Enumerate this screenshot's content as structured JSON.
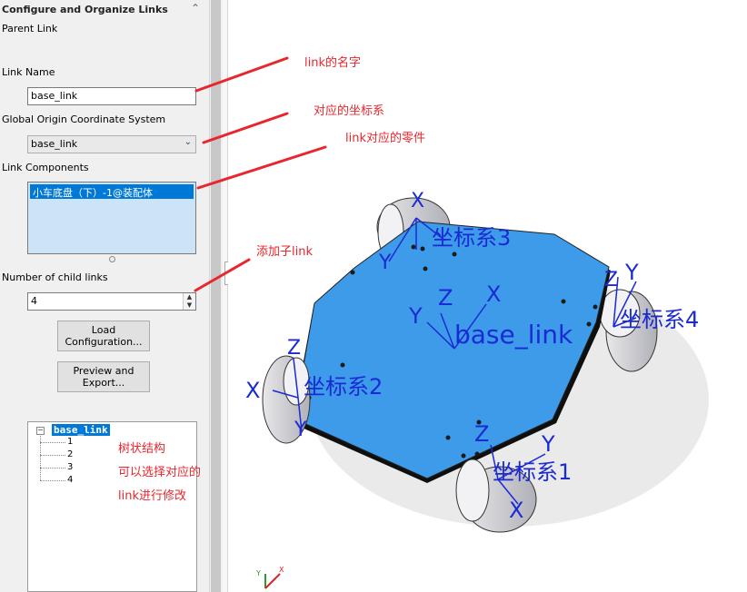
{
  "panel": {
    "title": "Configure and Organize Links",
    "parent_link_label": "Parent Link",
    "link_name_label": "Link Name",
    "link_name_value": "base_link",
    "coord_sys_label": "Global Origin Coordinate System",
    "coord_sys_value": "base_link",
    "components_label": "Link Components",
    "component_selected": "小车底盘（下）-1@装配体",
    "child_links_label": "Number of child links",
    "child_links_value": "4",
    "load_button": "Load\nConfiguration...",
    "preview_button": "Preview and\nExport...",
    "tree": {
      "root": "base_link",
      "toggle": "−",
      "children": [
        "1",
        "2",
        "3",
        "4"
      ]
    }
  },
  "annotations": {
    "link_name": "link的名字",
    "coord_sys": "对应的坐标系",
    "components": "link对应的零件",
    "child_links": "添加子link",
    "tree_lines": [
      "树状结构",
      "可以选择对应的",
      "link进行修改"
    ]
  },
  "viewport": {
    "axis_X": "X",
    "axis_Y": "Y",
    "axis_Z": "Z",
    "base_label": "base_link",
    "cs1": "坐标系1",
    "cs2": "坐标系2",
    "cs3": "坐标系3",
    "cs4": "坐标系4",
    "triad_y": "Y",
    "triad_x": "X"
  },
  "colors": {
    "annotation": "#e8262c",
    "plate": "#3d9be9",
    "axis": "#1a2ad4",
    "selection": "#0078d7"
  }
}
